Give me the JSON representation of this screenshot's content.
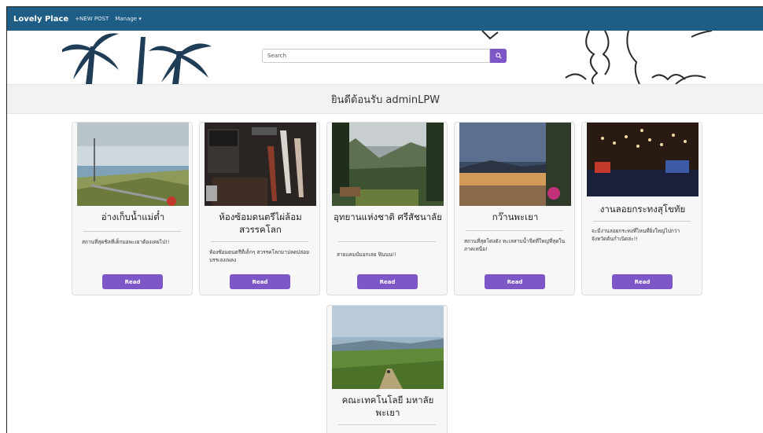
{
  "nav": {
    "brand": "Lovely Place",
    "new_post": "+NEW POST",
    "manage": "Manage ▾"
  },
  "search": {
    "placeholder": "Search",
    "icon": "search-icon"
  },
  "welcome": "ยินดีต้อนรับ adminLPW",
  "colors": {
    "navbar": "#1e5d86",
    "accent": "#7d57c8",
    "welcome_bg": "#f2f2f2"
  },
  "cards": [
    {
      "title": "อ่างเก็บน้ำแม่ต๋ำ",
      "desc": "สถานที่สุดชิลที่เด็กมอพะเยาต้องเคยไป!!",
      "button": "Read"
    },
    {
      "title": "ห้องซ้อมดนตรีไผ่ล้อม สวรรคโลก",
      "desc": "ห้องซ้อมดนตรีที่เด็กๆ สวรรคโลกมาปลดปล่อยบรรเลงเพลง",
      "button": "Read"
    },
    {
      "title": "อุทยานแห่งชาติ ศรีสัชนาลัย",
      "desc": "สายแคมป์มอกเลย ฟินนน!!",
      "button": "Read"
    },
    {
      "title": "กว๊านพะเยา",
      "desc": "สถานที่สุดโด่งดัง ทะเลสาบน้ำจืดที่ใหญ่ที่สุดในภาคเหนือ!",
      "button": "Read"
    },
    {
      "title": "งานลอยกระทงสุโขทัย",
      "desc": "จะมีงานลอยกระทงที่ไหนที่ยิ่งใหญ่ไปกว่าจังหวัดต้นกำเนิดล่ะ!!",
      "button": "Read"
    },
    {
      "title": "คณะเทคโนโลยี มหาลัย พะเยา",
      "desc": "",
      "button": ""
    }
  ]
}
